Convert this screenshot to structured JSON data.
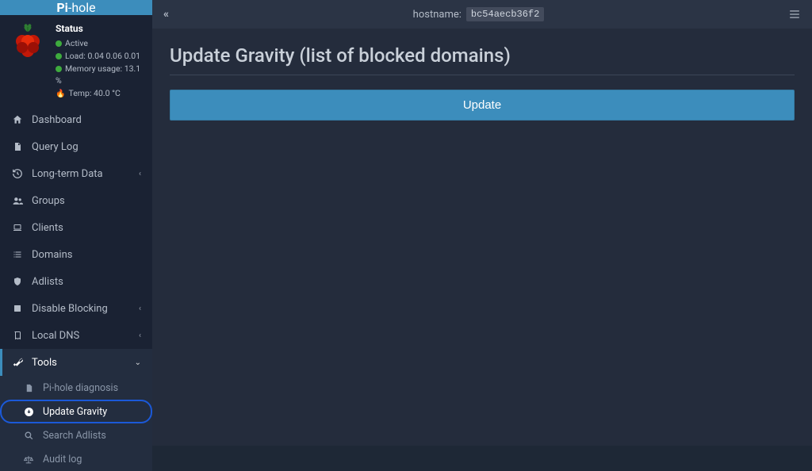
{
  "brand": {
    "prefix": "Pi",
    "suffix": "-hole"
  },
  "status": {
    "title": "Status",
    "active": "Active",
    "load_label": "Load:",
    "load_values": "0.04  0.06  0.01",
    "mem_label": "Memory usage:",
    "mem_value": "13.1 %",
    "temp_label": "Temp:",
    "temp_value": "40.0 °C"
  },
  "nav": {
    "dashboard": "Dashboard",
    "query_log": "Query Log",
    "longterm": "Long-term Data",
    "groups": "Groups",
    "clients": "Clients",
    "domains": "Domains",
    "adlists": "Adlists",
    "disable": "Disable Blocking",
    "localdns": "Local DNS",
    "tools": "Tools"
  },
  "subnav": {
    "diagnosis": "Pi-hole diagnosis",
    "gravity": "Update Gravity",
    "search": "Search Adlists",
    "audit": "Audit log"
  },
  "topbar": {
    "hostname_label": "hostname:",
    "hostname_value": "bc54aecb36f2"
  },
  "page": {
    "title": "Update Gravity (list of blocked domains)",
    "update_button": "Update"
  }
}
